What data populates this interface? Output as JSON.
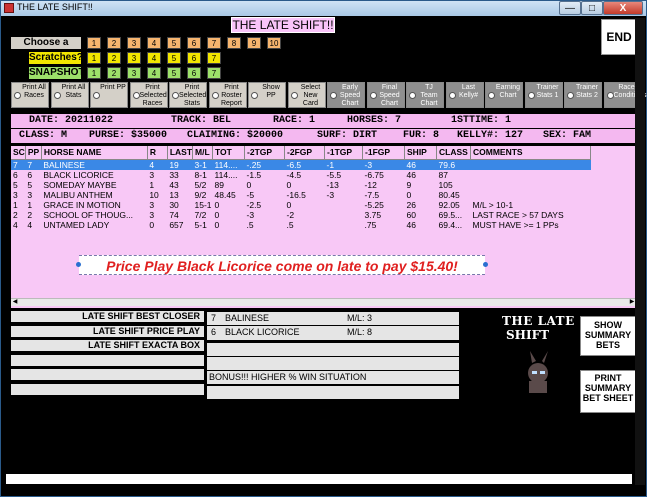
{
  "window": {
    "title": "THE LATE SHIFT!!",
    "min": "—",
    "max": "□",
    "close": "X"
  },
  "header": {
    "title": "THE LATE SHIFT!!",
    "end_label": "END"
  },
  "race_row": {
    "label": "Choose a race:",
    "buttons": [
      "1",
      "2",
      "3",
      "4",
      "5",
      "6",
      "7",
      "8",
      "9",
      "10"
    ]
  },
  "scratch_row": {
    "label": "Scratches?",
    "buttons": [
      "1",
      "2",
      "3",
      "4",
      "5",
      "6",
      "7"
    ]
  },
  "snapshot_row": {
    "label": "SNAPSHOT",
    "buttons": [
      "1",
      "2",
      "3",
      "4",
      "5",
      "6",
      "7"
    ]
  },
  "options": [
    {
      "label": "Print All Races"
    },
    {
      "label": "Print All Stats"
    },
    {
      "label": "Print PP"
    },
    {
      "label": "Print Selected Races"
    },
    {
      "label": "Print Selected Stats"
    },
    {
      "label": "Print Roster Report"
    },
    {
      "label": "Show PP"
    },
    {
      "label": "Select New Card"
    },
    {
      "label": "Early Speed Chart"
    },
    {
      "label": "Final Speed Chart"
    },
    {
      "label": "TJ Team Chart"
    },
    {
      "label": "Last Kelly#"
    },
    {
      "label": "Earning Chart"
    },
    {
      "label": "Trainer Stats 1"
    },
    {
      "label": "Trainer Stats 2"
    },
    {
      "label": "Race Conditions"
    }
  ],
  "race_info": {
    "date": "DATE: 20211022",
    "track": "TRACK: BEL",
    "race": "RACE: 1",
    "horses": "HORSES: 7",
    "firsttime": "1STTIME: 1",
    "class": "CLASS: M",
    "purse": "PURSE: $35000",
    "claiming": "CLAIMING: $20000",
    "surf": "SURF: DIRT",
    "fur": "FUR: 8",
    "kelly": "KELLY#: 127",
    "sex": "SEX: FAM"
  },
  "table": {
    "columns": [
      "SC",
      "PP",
      "HORSE NAME",
      "R",
      "LAST",
      "M/L",
      "TOT",
      "-2TGP",
      "-2FGP",
      "-1TGP",
      "-1FGP",
      "SHIP",
      "CLASS",
      "COMMENTS"
    ],
    "rows": [
      [
        "7",
        "7",
        "BALINESE",
        "4",
        "19",
        "3-1",
        "114....",
        "-.25",
        "-6.5",
        "-1",
        "-3",
        "46",
        "79.6",
        ""
      ],
      [
        "6",
        "6",
        "BLACK LICORICE",
        "3",
        "33",
        "8-1",
        "114....",
        "-1.5",
        "-4.5",
        "-5.5",
        "-6.75",
        "46",
        "87",
        ""
      ],
      [
        "5",
        "5",
        "SOMEDAY MAYBE",
        "1",
        "43",
        "5/2",
        "89",
        "0",
        "0",
        "-13",
        "-12",
        "9",
        "105",
        ""
      ],
      [
        "3",
        "3",
        "MALIBU ANTHEM",
        "10",
        "13",
        "9/2",
        "48.45",
        "-5",
        "-16.5",
        "-3",
        "-7.5",
        "0",
        "80.45",
        ""
      ],
      [
        "1",
        "1",
        "GRACE IN MOTION",
        "3",
        "30",
        "15-1",
        "0",
        "-2.5",
        "0",
        "",
        "-5.25",
        "26",
        "92.05",
        "M/L > 10-1"
      ],
      [
        "2",
        "2",
        "SCHOOL OF THOUG...",
        "3",
        "74",
        "7/2",
        "0",
        "-3",
        "-2",
        "",
        "3.75",
        "60",
        "69.5...",
        "LAST RACE > 57 DAYS"
      ],
      [
        "4",
        "4",
        "UNTAMED LADY",
        "0",
        "657",
        "5-1",
        "0",
        ".5",
        ".5",
        "",
        ".75",
        "46",
        "69.4...",
        "MUST HAVE >= 1 PPs"
      ]
    ],
    "selected_row": 0
  },
  "promo": "Price Play Black Licorice come on late to pay $15.40!",
  "left_boxes": [
    "LATE SHIFT BEST CLOSER",
    "LATE SHIFT PRICE PLAY",
    "LATE SHIFT EXACTA BOX",
    "",
    "",
    ""
  ],
  "picks": [
    {
      "num": "7",
      "name": "BALINESE",
      "ml": "M/L: 3"
    },
    {
      "num": "6",
      "name": "BLACK LICORICE",
      "ml": "M/L: 8"
    }
  ],
  "bonus": "BONUS!!! HIGHER % WIN SITUATION",
  "logo": {
    "line1": "THE LATE",
    "line2": "SHIFT"
  },
  "buttons": {
    "summary_bets": "SHOW SUMMARY BETS",
    "print_sheet": "PRINT SUMMARY BET SHEET"
  },
  "colors": {
    "pink": "#f9c4f9",
    "selected": "#3a88e6",
    "promo_text": "#e02020",
    "race_button": "#f6b56f",
    "scratch_button": "#f2e600",
    "snapshot_button": "#9de06a"
  }
}
